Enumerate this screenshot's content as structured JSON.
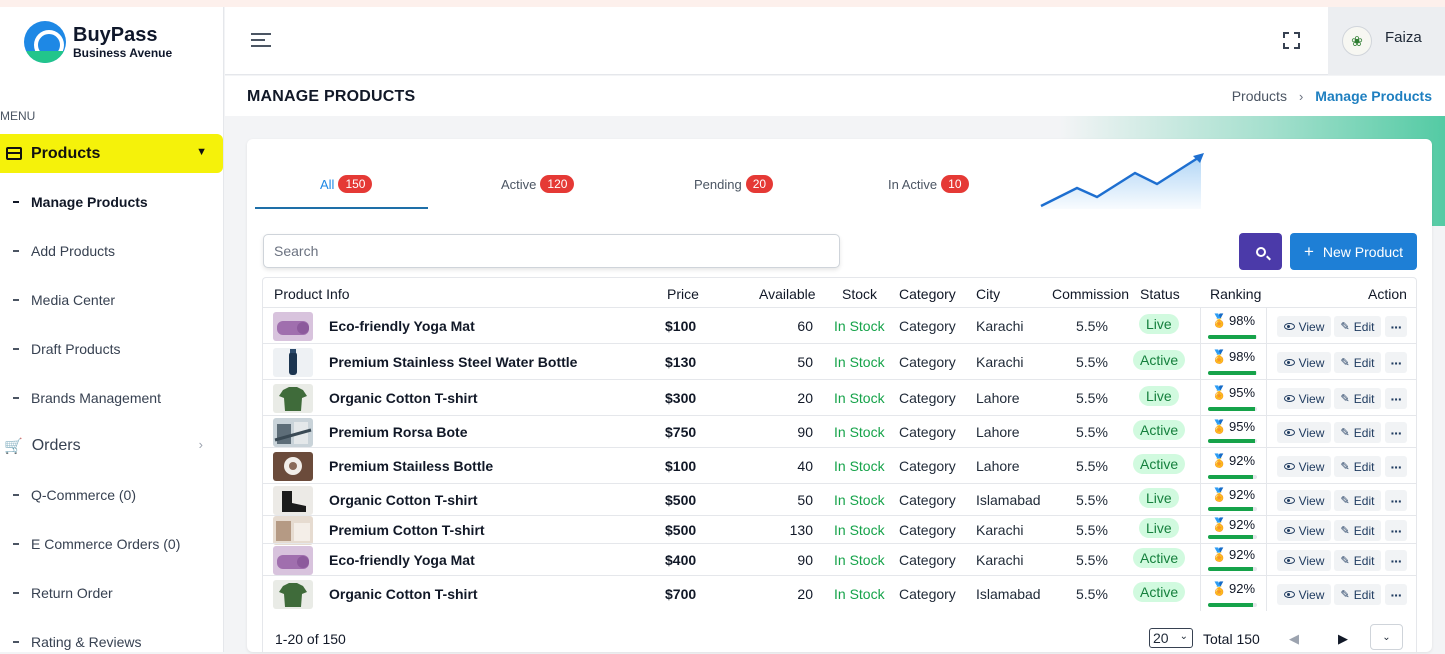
{
  "brand": {
    "title": "BuyPass",
    "subtitle": "Business Avenue"
  },
  "sidebar": {
    "menu_label": "MENU",
    "products_label": "Products",
    "product_items": [
      "Manage Products",
      "Add Products",
      "Media Center",
      "Draft Products",
      "Brands Management"
    ],
    "orders_label": "Orders",
    "order_items": [
      "Q-Commerce (0)",
      "E Commerce Orders (0)",
      "Return Order",
      "Rating & Reviews"
    ]
  },
  "header": {
    "username": "Faiza"
  },
  "page": {
    "title": "MANAGE PRODUCTS",
    "breadcrumb": [
      "Products",
      "Manage Products"
    ]
  },
  "tabs": [
    {
      "label": "All",
      "count": "150"
    },
    {
      "label": "Active",
      "count": "120"
    },
    {
      "label": "Pending",
      "count": "20"
    },
    {
      "label": "In Active",
      "count": "10"
    }
  ],
  "search": {
    "placeholder": "Search"
  },
  "new_button": "New Product",
  "table": {
    "columns": [
      "Product Info",
      "Price",
      "Available",
      "Stock",
      "Category",
      "City",
      "Commission",
      "Status",
      "Ranking",
      "Action"
    ],
    "rows": [
      {
        "name": "Eco-friendly Yoga Mat",
        "price": "$100",
        "available": "60",
        "stock": "In Stock",
        "category": "Category",
        "city": "Karachi",
        "commission": "5.5%",
        "status": "Live",
        "ranking": "98%",
        "rank_value": 0.98,
        "thumb": "yoga"
      },
      {
        "name": "Premium Stainless Steel Water Bottle",
        "price": "$130",
        "available": "50",
        "stock": "In Stock",
        "category": "Category",
        "city": "Karachi",
        "commission": "5.5%",
        "status": "Active",
        "ranking": "98%",
        "rank_value": 0.98,
        "thumb": "bottle"
      },
      {
        "name": "Organic Cotton T-shirt",
        "price": "$300",
        "available": "20",
        "stock": "In Stock",
        "category": "Category",
        "city": "Lahore",
        "commission": "5.5%",
        "status": "Live",
        "ranking": "95%",
        "rank_value": 0.95,
        "thumb": "tshirt"
      },
      {
        "name": "Premium Rorsa Bote",
        "price": "$750",
        "available": "90",
        "stock": "In Stock",
        "category": "Category",
        "city": "Lahore",
        "commission": "5.5%",
        "status": "Active",
        "ranking": "95%",
        "rank_value": 0.95,
        "thumb": "bote"
      },
      {
        "name": "Premium Staiıless Bottle",
        "price": "$100",
        "available": "40",
        "stock": "In Stock",
        "category": "Category",
        "city": "Lahore",
        "commission": "5.5%",
        "status": "Active",
        "ranking": "92%",
        "rank_value": 0.92,
        "thumb": "bottle2"
      },
      {
        "name": "Organic Cotton T-shirt",
        "price": "$500",
        "available": "50",
        "stock": "In Stock",
        "category": "Category",
        "city": "Islamabad",
        "commission": "5.5%",
        "status": "Live",
        "ranking": "92%",
        "rank_value": 0.92,
        "thumb": "shoe"
      },
      {
        "name": "Premium Cotton T-shirt",
        "price": "$500",
        "available": "130",
        "stock": "In Stock",
        "category": "Category",
        "city": "Karachi",
        "commission": "5.5%",
        "status": "Live",
        "ranking": "92%",
        "rank_value": 0.92,
        "thumb": "cotton"
      },
      {
        "name": "Eco-friendly Yoga Mat",
        "price": "$400",
        "available": "90",
        "stock": "In Stock",
        "category": "Category",
        "city": "Karachi",
        "commission": "5.5%",
        "status": "Active",
        "ranking": "92%",
        "rank_value": 0.92,
        "thumb": "yoga"
      },
      {
        "name": "Organic Cotton T-shirt",
        "price": "$700",
        "available": "20",
        "stock": "In Stock",
        "category": "Category",
        "city": "Islamabad",
        "commission": "5.5%",
        "status": "Active",
        "ranking": "92%",
        "rank_value": 0.92,
        "thumb": "tshirt"
      }
    ],
    "actions": {
      "view": "View",
      "edit": "Edit"
    }
  },
  "pagination": {
    "range": "1-20 of 150",
    "per_page": "20",
    "total": "Total 150"
  },
  "colors": {
    "accent": "#1e7fd6",
    "sidebar_active": "#f5f20a",
    "badge": "#e53935",
    "stock": "#16a34a",
    "search_button": "#4b3aa9"
  },
  "icons": [
    "hamburger-icon",
    "fullscreen-icon",
    "search-icon",
    "plus-icon",
    "eye-icon",
    "pencil-icon",
    "more-icon",
    "medal-icon",
    "cart-icon",
    "chevron-down-icon",
    "chevron-right-icon"
  ]
}
